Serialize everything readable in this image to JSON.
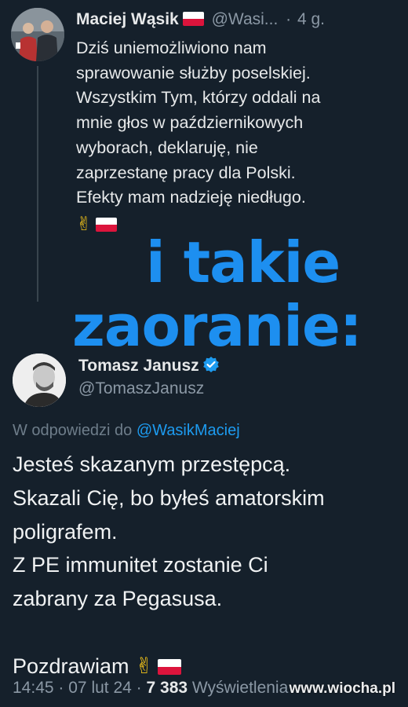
{
  "parent_tweet": {
    "author_name": "Maciej Wąsik",
    "author_handle": "@Wasi...",
    "separator": "·",
    "time_ago": "4 g.",
    "lines": [
      "Dziś uniemożliwiono nam",
      "sprawowanie służby poselskiej.",
      "Wszystkim Tym, którzy oddali na",
      "mnie głos w październikowych",
      "wyborach, deklaruję, nie",
      "zaprzestanę pracy dla Polski.",
      "Efekty mam nadzieję  niedługo."
    ],
    "emoji": "✌"
  },
  "overlay": {
    "line1": "i takie",
    "line2": "zaoranie:",
    "color": "#1d8ff0"
  },
  "reply_tweet": {
    "author_name": "Tomasz Janusz",
    "author_handle": "@TomaszJanusz",
    "reply_prefix": "W odpowiedzi do",
    "reply_to_handle": "@WasikMaciej",
    "lines": [
      "Jesteś skazanym przestępcą.",
      "Skazali Cię, bo byłeś amatorskim",
      "poligrafem.",
      "Z PE immunitet zostanie Ci",
      "zabrany za Pegasusa."
    ],
    "closing": "Pozdrawiam",
    "emoji": "✌",
    "time": "14:45",
    "separator": "·",
    "date": "07 lut 24",
    "views_count": "7 383",
    "views_label": "Wyświetlenia"
  },
  "watermark": "www.wiocha.pl",
  "colors": {
    "background": "#15202b",
    "text": "#e7e9ea",
    "muted": "#8b98a5",
    "link": "#1d9bf0",
    "verified": "#1d9bf0"
  }
}
